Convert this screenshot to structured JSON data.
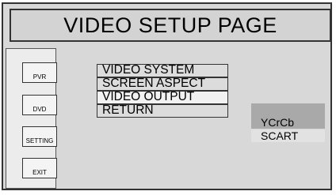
{
  "page": {
    "title": "VIDEO SETUP PAGE"
  },
  "sidebar": {
    "buttons": [
      {
        "label": "PVR"
      },
      {
        "label": "DVD"
      },
      {
        "label": "SETTING"
      },
      {
        "label": "EXIT"
      }
    ]
  },
  "menu": {
    "items": [
      {
        "label": "VIDEO SYSTEM"
      },
      {
        "label": "SCREEN ASPECT"
      },
      {
        "label": "VIDEO OUTPUT",
        "highlighted": true
      },
      {
        "label": "RETURN"
      }
    ]
  },
  "submenu": {
    "options": [
      {
        "label": "YCrCb",
        "selected": true
      },
      {
        "label": "SCART",
        "selected": false
      }
    ]
  }
}
